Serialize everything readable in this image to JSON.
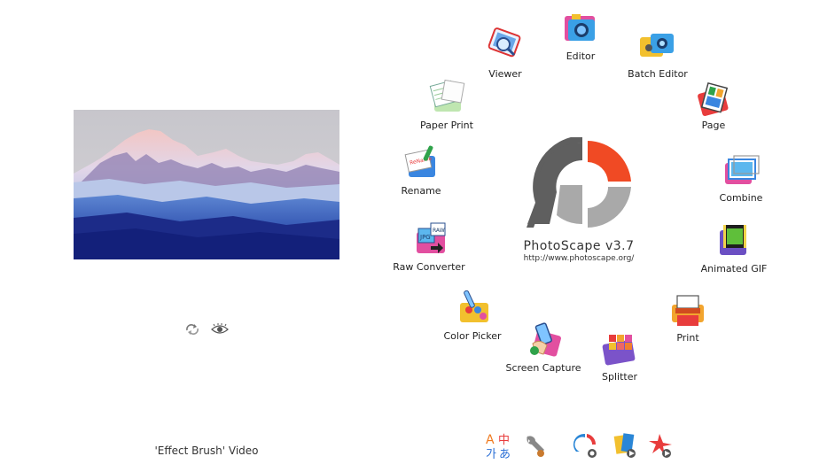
{
  "preview": {
    "caption": "'Effect Brush' Video"
  },
  "brand": {
    "title": "PhotoScape v3.7",
    "url": "http://www.photoscape.org/",
    "colors": {
      "dark": "#5f5f5f",
      "light": "#a9a9a9",
      "accent": "#f04a24"
    }
  },
  "apps": [
    {
      "label": "Viewer",
      "icon": "viewer-icon"
    },
    {
      "label": "Editor",
      "icon": "editor-icon"
    },
    {
      "label": "Batch Editor",
      "icon": "batch-editor-icon"
    },
    {
      "label": "Page",
      "icon": "page-icon"
    },
    {
      "label": "Combine",
      "icon": "combine-icon"
    },
    {
      "label": "Animated GIF",
      "icon": "animated-gif-icon"
    },
    {
      "label": "Print",
      "icon": "print-icon"
    },
    {
      "label": "Splitter",
      "icon": "splitter-icon"
    },
    {
      "label": "Screen Capture",
      "icon": "screen-capture-icon"
    },
    {
      "label": "Color Picker",
      "icon": "color-picker-icon"
    },
    {
      "label": "Raw Converter",
      "icon": "raw-converter-icon"
    },
    {
      "label": "Rename",
      "icon": "rename-icon"
    },
    {
      "label": "Paper Print",
      "icon": "paper-print-icon"
    }
  ],
  "toolbar": {
    "language_glyphs": {
      "top_left": "A",
      "top_right": "中",
      "bottom_left": "가",
      "bottom_right": "あ"
    },
    "tools": [
      "language-icon",
      "tools-icon",
      "photoscape-update-icon",
      "slideshow-icon",
      "photoscape-x-icon"
    ]
  }
}
